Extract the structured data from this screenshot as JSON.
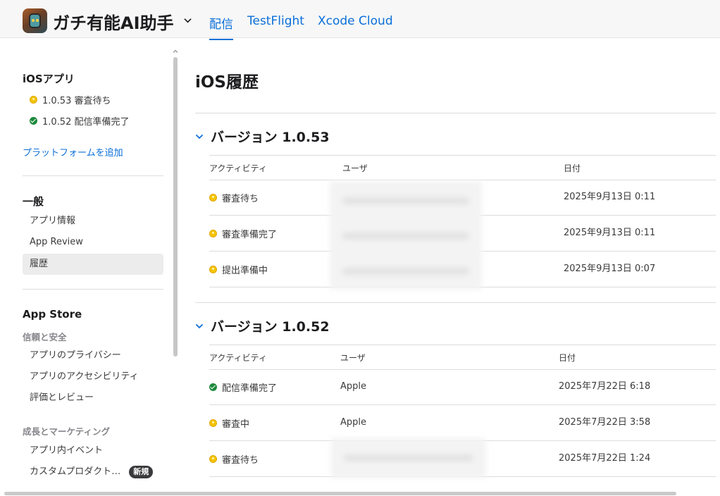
{
  "header": {
    "app_name": "ガチ有能AI助手",
    "tabs": [
      {
        "label": "配信",
        "active": true
      },
      {
        "label": "TestFlight",
        "active": false
      },
      {
        "label": "Xcode Cloud",
        "active": false
      }
    ]
  },
  "sidebar": {
    "ios_section": {
      "title": "iOSアプリ",
      "versions": [
        {
          "label": "1.0.53 審査待ち",
          "status": "pending"
        },
        {
          "label": "1.0.52 配信準備完了",
          "status": "ready"
        }
      ],
      "add_platform": "プラットフォームを追加"
    },
    "general": {
      "title": "一般",
      "items": [
        "アプリ情報",
        "App Review",
        "履歴"
      ],
      "selected": "履歴"
    },
    "app_store": {
      "title": "App Store",
      "trust_title": "信頼と安全",
      "trust_items": [
        "アプリのプライバシー",
        "アプリのアクセシビリティ",
        "評価とレビュー"
      ],
      "growth_title": "成長とマーケティング",
      "growth_items": [
        "アプリ内イベント",
        "カスタムプロダクト…"
      ],
      "new_badge": "新規"
    }
  },
  "main": {
    "title": "iOS履歴",
    "columns": {
      "activity": "アクティビティ",
      "user": "ユーザ",
      "date": "日付"
    },
    "versions": [
      {
        "title": "バージョン 1.0.53",
        "rows": [
          {
            "activity": "審査待ち",
            "status": "pending",
            "user": "",
            "date": "2025年9月13日 0:11"
          },
          {
            "activity": "審査準備完了",
            "status": "pending",
            "user": "",
            "date": "2025年9月13日 0:11"
          },
          {
            "activity": "提出準備中",
            "status": "pending",
            "user": "",
            "date": "2025年9月13日 0:07"
          }
        ]
      },
      {
        "title": "バージョン 1.0.52",
        "rows": [
          {
            "activity": "配信準備完了",
            "status": "ready",
            "user": "Apple",
            "date": "2025年7月22日 6:18"
          },
          {
            "activity": "審査中",
            "status": "pending",
            "user": "Apple",
            "date": "2025年7月22日 3:58"
          },
          {
            "activity": "審査待ち",
            "status": "pending",
            "user": "",
            "date": "2025年7月22日 1:24"
          }
        ]
      }
    ]
  },
  "colors": {
    "accent": "#0a6fd8",
    "pending": "#f5c400",
    "ready": "#1e8a3c"
  }
}
